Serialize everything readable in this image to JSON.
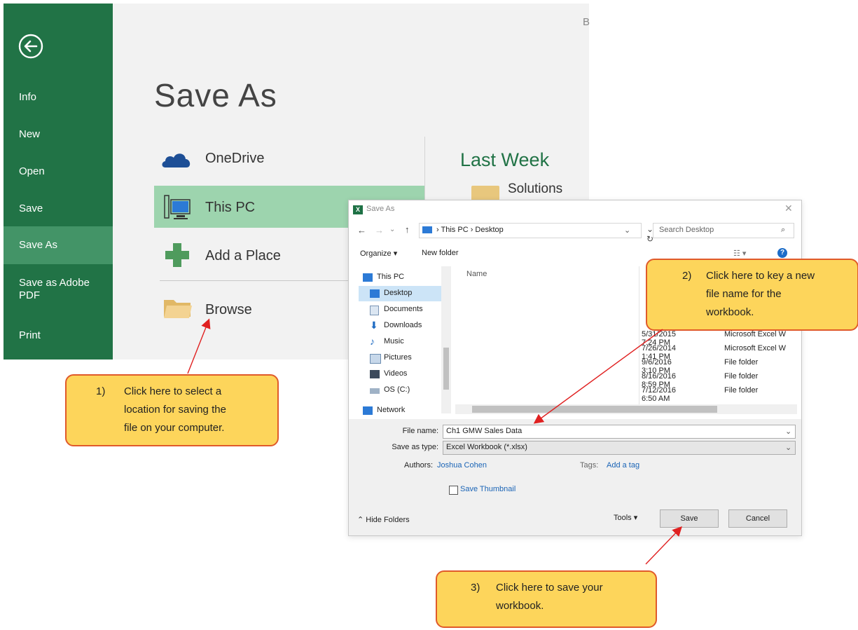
{
  "backstage": {
    "nav": [
      "Info",
      "New",
      "Open",
      "Save",
      "Save As",
      "Save as Adobe PDF",
      "Print"
    ],
    "selected_nav": "Save As",
    "title": "Save As",
    "corner_letter": "B",
    "locations": [
      "OneDrive",
      "This PC",
      "Add a Place",
      "Browse"
    ],
    "selected_location": "This PC",
    "recent_heading": "Last Week",
    "recent_folder": "Solutions"
  },
  "dialog": {
    "title": "Save As",
    "close": "✕",
    "path": "›  This PC  ›  Desktop",
    "search_placeholder": "Search Desktop",
    "organize": "Organize ▾",
    "new_folder": "New folder",
    "tree": [
      "This PC",
      "Desktop",
      "Documents",
      "Downloads",
      "Music",
      "Pictures",
      "Videos",
      "OS (C:)",
      "Network"
    ],
    "selected_tree": "Desktop",
    "column_name": "Name",
    "files": [
      {
        "date": "5/31/2015 7:24 PM",
        "type": "Microsoft Excel W"
      },
      {
        "date": "7/26/2014 1:41 PM",
        "type": "Microsoft Excel W"
      },
      {
        "date": "9/6/2016 3:10 PM",
        "type": "File folder"
      },
      {
        "date": "8/16/2016 8:59 PM",
        "type": "File folder"
      },
      {
        "date": "7/12/2016 6:50 AM",
        "type": "File folder"
      }
    ],
    "file_name_label": "File name:",
    "file_name_value": "Ch1 GMW Sales Data",
    "save_as_type_label": "Save as type:",
    "save_as_type_value": "Excel Workbook (*.xlsx)",
    "authors_label": "Authors:",
    "authors_value": "Joshua Cohen",
    "tags_label": "Tags:",
    "tags_value": "Add a tag",
    "save_thumbnail": "Save Thumbnail",
    "hide_folders": "Hide Folders",
    "tools": "Tools",
    "save": "Save",
    "cancel": "Cancel"
  },
  "callouts": {
    "c1_num": "1)",
    "c1_lines": [
      "Click here to select a",
      "location for saving the",
      "file on your computer."
    ],
    "c2_num": "2)",
    "c2_lines": [
      "Click here to key a new",
      "file name for the",
      "workbook."
    ],
    "c3_num": "3)",
    "c3_lines": [
      "Click here to save your",
      "workbook."
    ]
  },
  "colors": {
    "nav_green": "#217346",
    "selected_location": "#9dd4ae",
    "callout_fill": "#fdd55b",
    "callout_border": "#e05a2a",
    "arrow": "#e02020"
  }
}
